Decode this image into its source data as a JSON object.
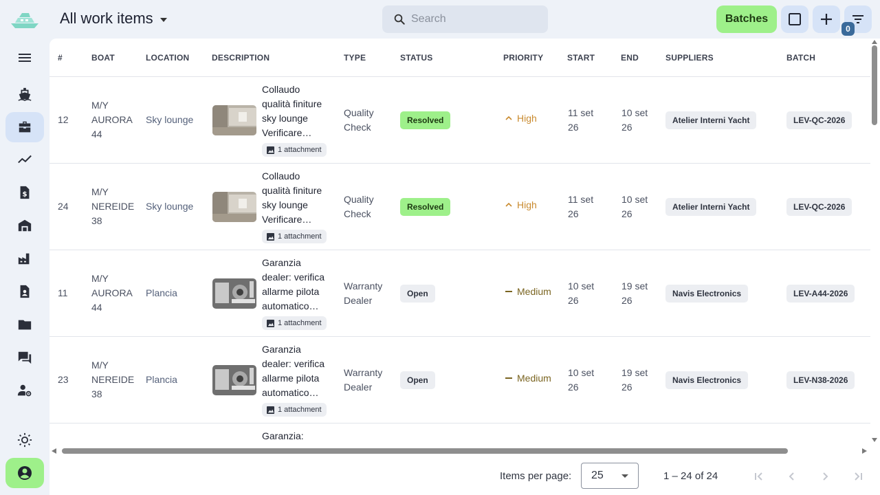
{
  "header": {
    "title": "All work items",
    "search_placeholder": "Search",
    "batches_label": "Batches",
    "filter_count": "0"
  },
  "colors": {
    "accent_green": "#9ef08a",
    "accent_blue": "#d6e3f7",
    "badge": "#3a6a9a",
    "priority_high": "#c98a2e",
    "priority_medium": "#7a6420"
  },
  "sidebar": {
    "items": [
      {
        "name": "menu-icon"
      },
      {
        "name": "boat-icon"
      },
      {
        "name": "briefcase-icon",
        "active": true
      },
      {
        "name": "trending-icon"
      },
      {
        "name": "invoice-icon"
      },
      {
        "name": "warehouse-icon"
      },
      {
        "name": "factory-icon"
      },
      {
        "name": "contact-document-icon"
      },
      {
        "name": "folder-icon"
      },
      {
        "name": "forum-icon"
      },
      {
        "name": "user-settings-icon"
      },
      {
        "name": "theme-icon"
      },
      {
        "name": "account-icon"
      }
    ]
  },
  "table": {
    "columns": [
      "#",
      "BOAT",
      "LOCATION",
      "DESCRIPTION",
      "TYPE",
      "STATUS",
      "PRIORITY",
      "START",
      "END",
      "SUPPLIERS",
      "BATCH"
    ],
    "rows": [
      {
        "id": "12",
        "boat": [
          "M/Y",
          "AURORA",
          "44"
        ],
        "location": "Sky lounge",
        "description": [
          "Collaudo",
          "qualità finiture",
          "sky lounge",
          "Verificare…"
        ],
        "attachment": "1 attachment",
        "type": [
          "Quality",
          "Check"
        ],
        "status": "Resolved",
        "priority": "High",
        "start": [
          "11 set",
          "26"
        ],
        "end": [
          "10 set",
          "26"
        ],
        "supplier": "Atelier Interni Yacht",
        "batch": "LEV-QC-2026"
      },
      {
        "id": "24",
        "boat": [
          "M/Y",
          "NEREIDE",
          "38"
        ],
        "location": "Sky lounge",
        "description": [
          "Collaudo",
          "qualità finiture",
          "sky lounge",
          "Verificare…"
        ],
        "attachment": "1 attachment",
        "type": [
          "Quality",
          "Check"
        ],
        "status": "Resolved",
        "priority": "High",
        "start": [
          "11 set",
          "26"
        ],
        "end": [
          "10 set",
          "26"
        ],
        "supplier": "Atelier Interni Yacht",
        "batch": "LEV-QC-2026"
      },
      {
        "id": "11",
        "boat": [
          "M/Y",
          "AURORA",
          "44"
        ],
        "location": "Plancia",
        "description": [
          "Garanzia",
          "dealer: verifica",
          "allarme pilota",
          "automatico…"
        ],
        "attachment": "1 attachment",
        "type": [
          "Warranty",
          "Dealer"
        ],
        "status": "Open",
        "priority": "Medium",
        "start": [
          "10 set",
          "26"
        ],
        "end": [
          "19 set",
          "26"
        ],
        "supplier": "Navis Electronics",
        "batch": "LEV-A44-2026"
      },
      {
        "id": "23",
        "boat": [
          "M/Y",
          "NEREIDE",
          "38"
        ],
        "location": "Plancia",
        "description": [
          "Garanzia",
          "dealer: verifica",
          "allarme pilota",
          "automatico…"
        ],
        "attachment": "1 attachment",
        "type": [
          "Warranty",
          "Dealer"
        ],
        "status": "Open",
        "priority": "Medium",
        "start": [
          "10 set",
          "26"
        ],
        "end": [
          "19 set",
          "26"
        ],
        "supplier": "Navis Electronics",
        "batch": "LEV-N38-2026"
      }
    ],
    "partial_row_text": "Garanzia:"
  },
  "paginator": {
    "items_per_page_label": "Items per page:",
    "items_per_page_value": "25",
    "range_label": "1 – 24 of 24"
  }
}
